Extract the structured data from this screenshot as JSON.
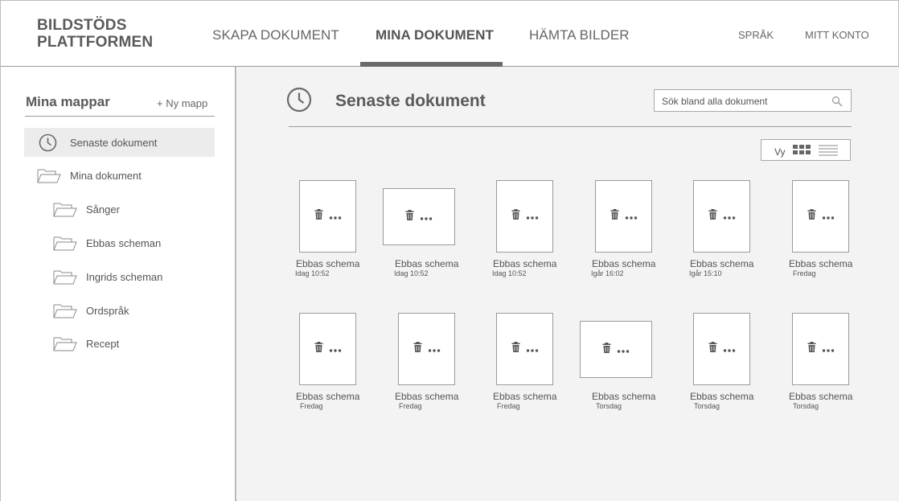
{
  "header": {
    "logo_line1": "BILDSTÖDS",
    "logo_line2": "PLATTFORMEN",
    "nav": [
      "SKAPA DOKUMENT",
      "MINA DOKUMENT",
      "HÄMTA BILDER"
    ],
    "active_nav": "MINA DOKUMENT",
    "language": "SPRÅK",
    "account": "MITT KONTO"
  },
  "sidebar": {
    "title": "Mina mappar",
    "new_folder": "+ Ny mapp",
    "recent": "Senaste dokument",
    "my_documents": "Mina dokument",
    "folders": [
      "Sånger",
      "Ebbas scheman",
      "Ingrids scheman",
      "Ordspråk",
      "Recept"
    ]
  },
  "main": {
    "title": "Senaste dokument",
    "search_placeholder": "Sök bland alla dokument",
    "view_label": "Vy"
  },
  "documents": [
    {
      "name": "Ebbas schema",
      "time": "Idag 10:52",
      "orientation": "portrait"
    },
    {
      "name": "Ebbas schema",
      "time": "Idag 10:52",
      "orientation": "landscape"
    },
    {
      "name": "Ebbas schema",
      "time": "Idag 10:52",
      "orientation": "portrait"
    },
    {
      "name": "Ebbas schema",
      "time": "Igår 16:02",
      "orientation": "portrait"
    },
    {
      "name": "Ebbas schema",
      "time": "Igår 15:10",
      "orientation": "portrait"
    },
    {
      "name": "Ebbas schema",
      "time": "Fredag",
      "orientation": "portrait"
    },
    {
      "name": "Ebbas schema",
      "time": "Fredag",
      "orientation": "portrait"
    },
    {
      "name": "Ebbas schema",
      "time": "Fredag",
      "orientation": "portrait"
    },
    {
      "name": "Ebbas schema",
      "time": "Fredag",
      "orientation": "portrait"
    },
    {
      "name": "Ebbas schema",
      "time": "Torsdag",
      "orientation": "landscape"
    },
    {
      "name": "Ebbas schema",
      "time": "Torsdag",
      "orientation": "portrait"
    },
    {
      "name": "Ebbas schema",
      "time": "Torsdag",
      "orientation": "portrait"
    }
  ],
  "icons": {
    "recent": "clock-icon",
    "folder": "folder-icon",
    "search": "search-icon",
    "grid_view": "grid-view-icon",
    "list_view": "list-view-icon",
    "delete": "trash-icon",
    "more": "more-options-icon"
  },
  "colors": {
    "header_bg": "#ffffff",
    "main_bg": "#f3f3f3",
    "text": "#555555",
    "active_underline": "#6a6a6a",
    "selected_item_bg": "#ececec"
  }
}
